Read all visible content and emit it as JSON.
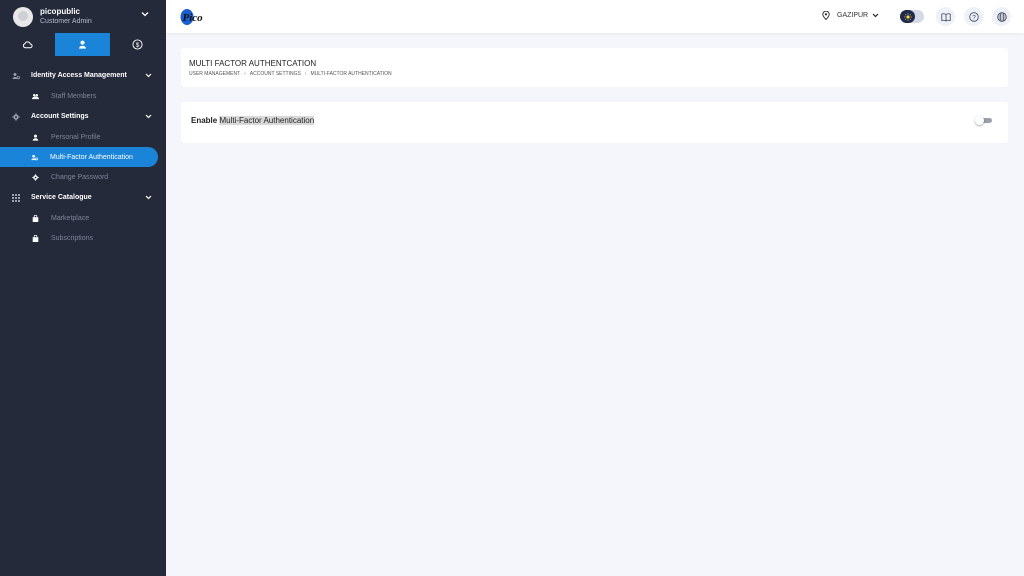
{
  "user": {
    "name": "picopublic",
    "role": "Customer Admin"
  },
  "mode_tabs": [
    {
      "icon": "cloud-icon"
    },
    {
      "icon": "user-icon",
      "active": true
    },
    {
      "icon": "dollar-icon"
    }
  ],
  "sidebar": {
    "groups": [
      {
        "label": "Identity Access Management",
        "icon": "users-cog-icon",
        "items": [
          {
            "label": "Staff Members",
            "icon": "users-icon"
          }
        ]
      },
      {
        "label": "Account Settings",
        "icon": "gear-icon",
        "items": [
          {
            "label": "Personal Profile",
            "icon": "user-icon"
          },
          {
            "label": "Multi-Factor Authentication",
            "icon": "users-cog-icon",
            "active": true
          },
          {
            "label": "Change Password",
            "icon": "gear-icon"
          }
        ]
      },
      {
        "label": "Service Catalogue",
        "icon": "grid-icon",
        "items": [
          {
            "label": "Marketplace",
            "icon": "bag-icon"
          },
          {
            "label": "Subscriptions",
            "icon": "bag-icon"
          }
        ]
      }
    ]
  },
  "topbar": {
    "logo_text": "Pico",
    "location": "GAZIPUR",
    "theme": "light"
  },
  "page": {
    "title": "MULTI FACTOR AUTHENTCATION",
    "breadcrumb": [
      "USER MANAGEMENT",
      "ACCOUNT SETTINGS",
      "MULTI-FACTOR AUTHENTICATION"
    ],
    "breadcrumb_sep": "›"
  },
  "mfa": {
    "label_prefix": "Enable ",
    "label_highlight": "Multi-Factor Authentication",
    "enabled": false
  },
  "colors": {
    "sidebar_bg": "#252a3b",
    "accent": "#1a84d9",
    "page_bg": "#f4f6fb"
  }
}
